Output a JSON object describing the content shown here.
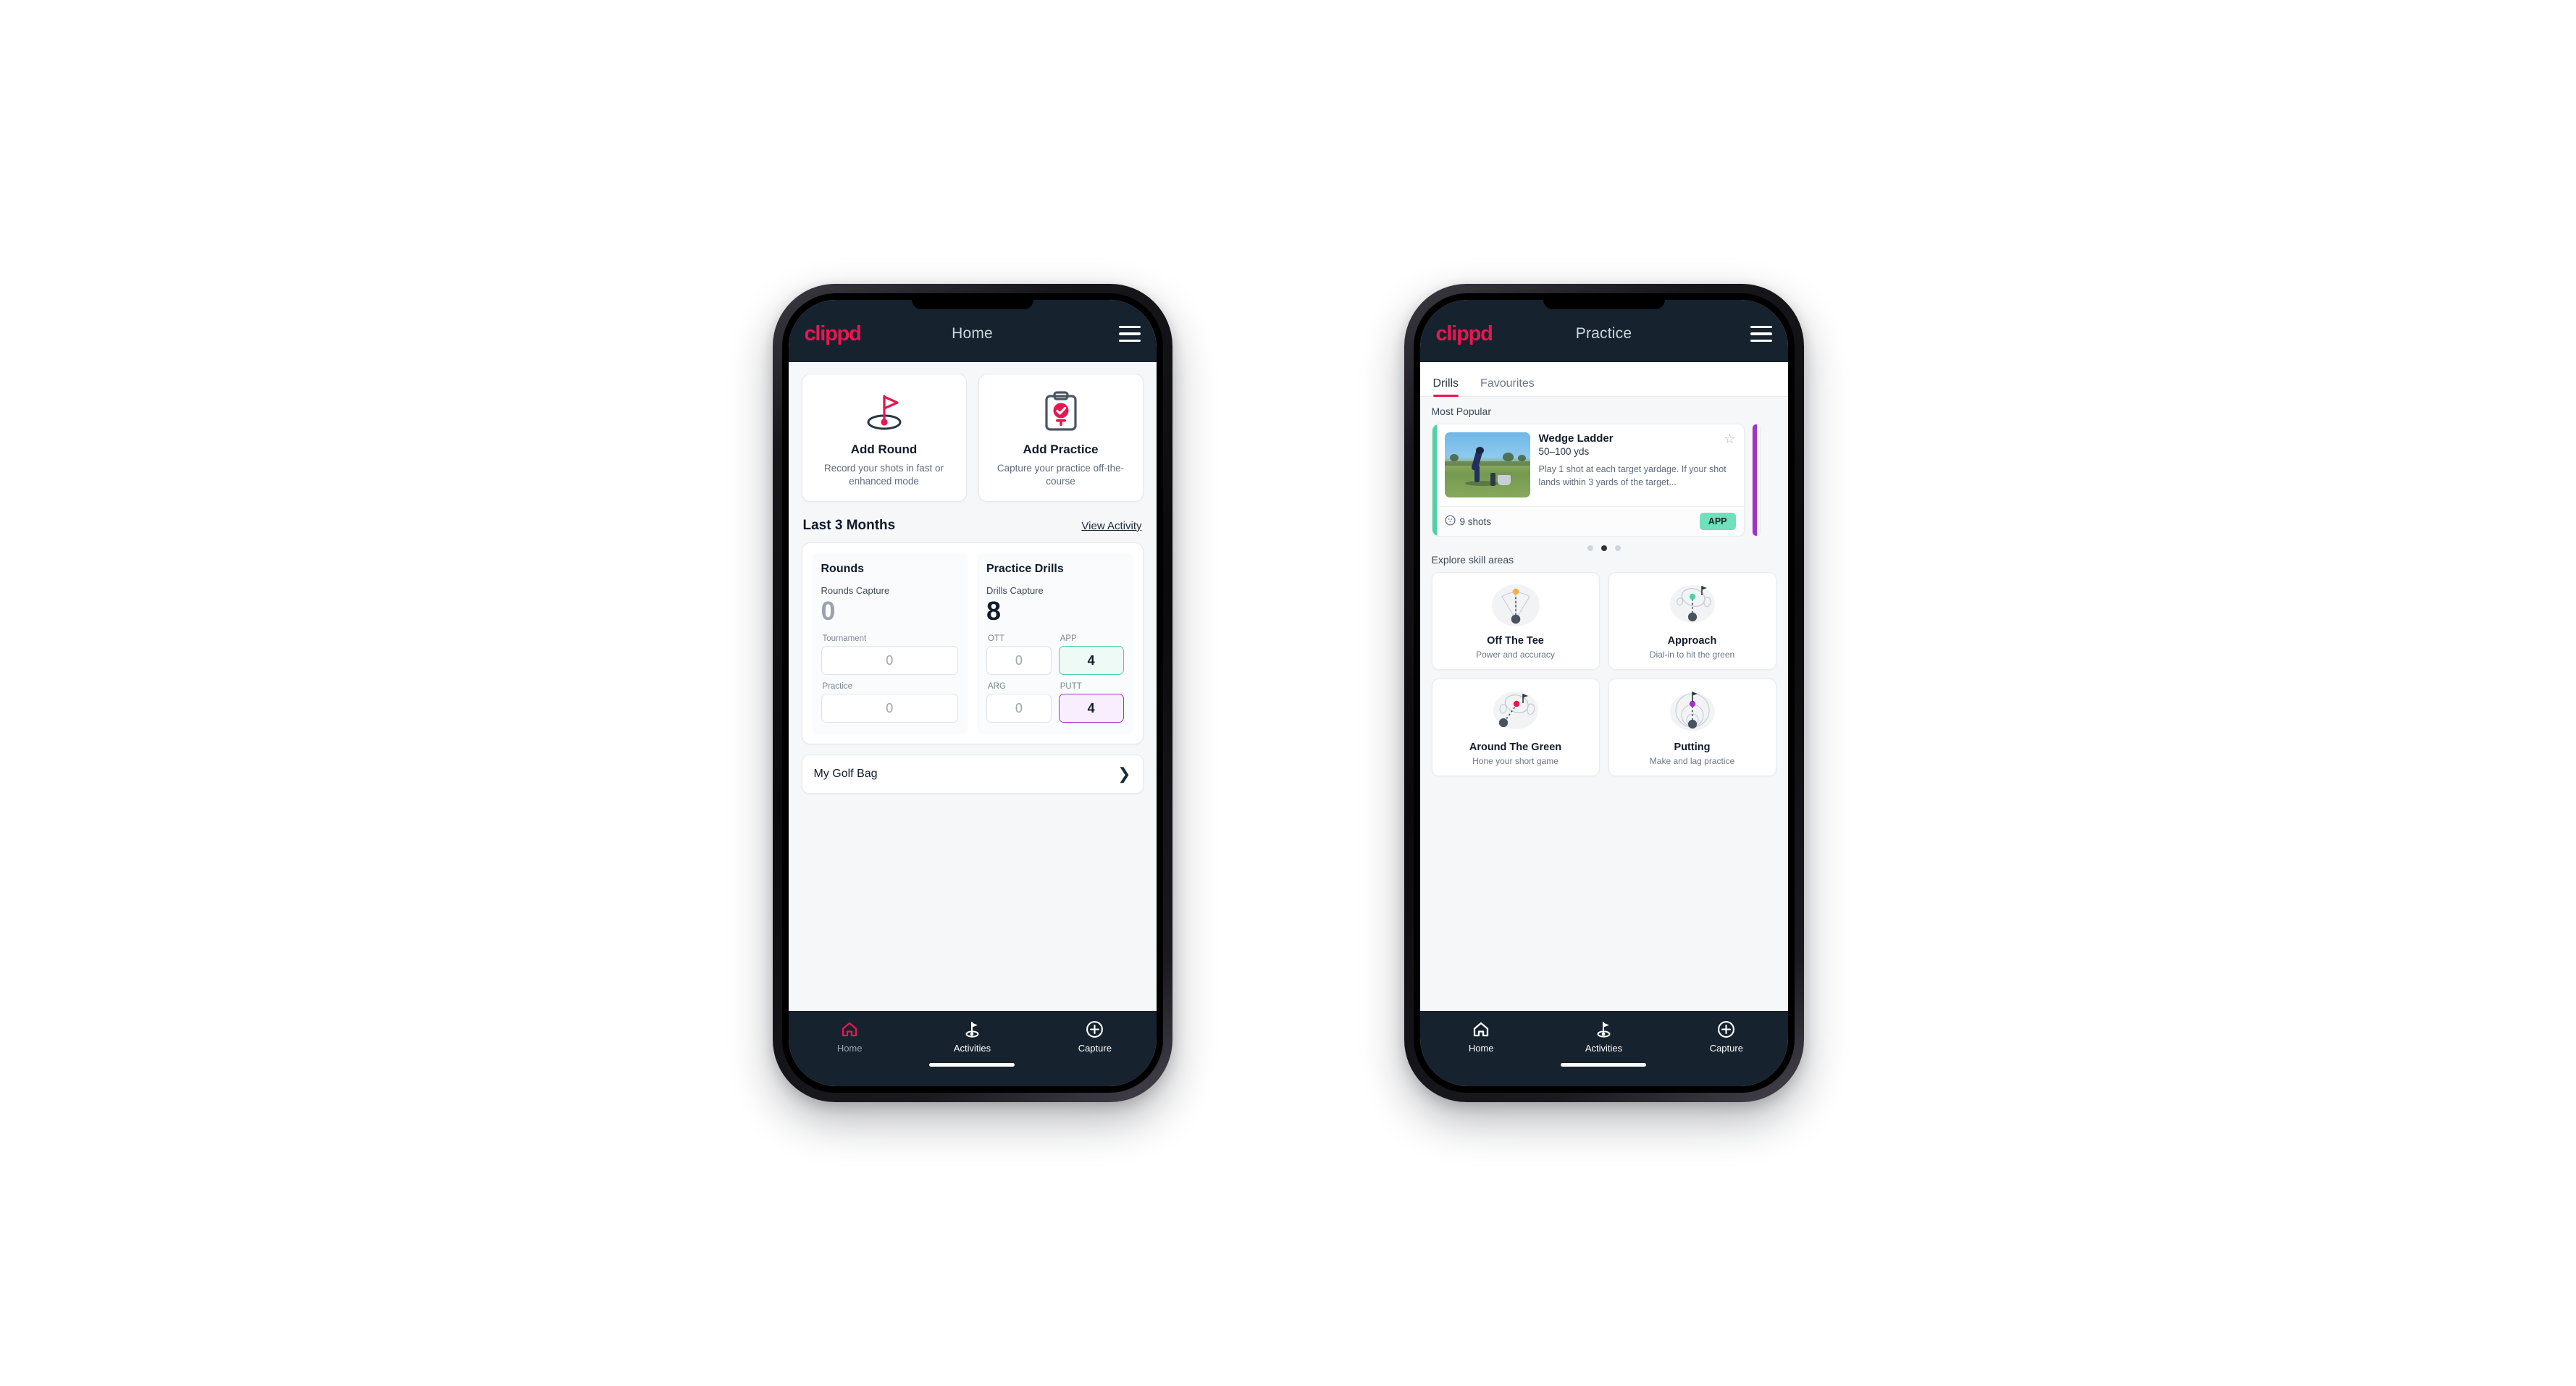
{
  "app": {
    "logo_text": "clippd",
    "brand_color": "#e8174f"
  },
  "phone_home": {
    "header": {
      "title": "Home",
      "menu_icon": "hamburger-icon"
    },
    "actions": [
      {
        "icon": "golf-flag-pin-icon",
        "title": "Add Round",
        "subtitle": "Record your shots in fast or enhanced mode"
      },
      {
        "icon": "clipboard-check-tee-icon",
        "title": "Add Practice",
        "subtitle": "Capture your practice off-the-course"
      }
    ],
    "section": {
      "title": "Last 3 Months",
      "link": "View Activity"
    },
    "stats": {
      "rounds": {
        "heading": "Rounds",
        "capture_label": "Rounds Capture",
        "capture_value": "0",
        "fields": [
          {
            "label": "Tournament",
            "value": "0",
            "state": "empty"
          },
          {
            "label": "Practice",
            "value": "0",
            "state": "empty"
          }
        ]
      },
      "drills": {
        "heading": "Practice Drills",
        "capture_label": "Drills Capture",
        "capture_value": "8",
        "fields": [
          {
            "label": "OTT",
            "value": "0",
            "state": "empty"
          },
          {
            "label": "APP",
            "value": "4",
            "state": "active-app",
            "color": "#4fd1a5"
          },
          {
            "label": "ARG",
            "value": "0",
            "state": "empty"
          },
          {
            "label": "PUTT",
            "value": "4",
            "state": "active-putt",
            "color": "#a233c9"
          }
        ]
      }
    },
    "golf_bag": {
      "label": "My Golf Bag",
      "chevron": "chevron-right-icon"
    },
    "bottom_nav": [
      {
        "icon": "home-icon",
        "label": "Home",
        "active": true
      },
      {
        "icon": "golf-flag-icon",
        "label": "Activities",
        "active": false
      },
      {
        "icon": "plus-circle-icon",
        "label": "Capture",
        "active": false
      }
    ]
  },
  "phone_practice": {
    "header": {
      "title": "Practice",
      "menu_icon": "hamburger-icon"
    },
    "tabs": [
      {
        "label": "Drills",
        "active": true
      },
      {
        "label": "Favourites",
        "active": false
      }
    ],
    "most_popular": {
      "heading": "Most Popular",
      "card": {
        "accent_color": "#4fd1a5",
        "title": "Wedge Ladder",
        "yardage": "50–100 yds",
        "description": "Play 1 shot at each target yardage. If your shot lands within 3 yards of the target...",
        "star_icon": "star-outline-icon",
        "shots_icon": "golf-ball-icon",
        "shots_label": "9 shots",
        "badge": "APP",
        "badge_color": "#6ee0bb",
        "thumbnail": "golfer-wedge-photo"
      },
      "next_card_accent": "#a233c9",
      "dots": {
        "count": 3,
        "active_index": 1
      }
    },
    "skill_areas": {
      "heading": "Explore skill areas",
      "cards": [
        {
          "art": "off-the-tee-fan-icon",
          "title": "Off The Tee",
          "subtitle": "Power and accuracy",
          "dot_color": "#f5b13d"
        },
        {
          "art": "approach-green-icon",
          "title": "Approach",
          "subtitle": "Dial-in to hit the green",
          "dot_color": "#4fd1a5"
        },
        {
          "art": "around-the-green-icon",
          "title": "Around The Green",
          "subtitle": "Hone your short game",
          "dot_color": "#e8174f"
        },
        {
          "art": "putting-rings-icon",
          "title": "Putting",
          "subtitle": "Make and lag practice",
          "dot_color": "#a233c9"
        }
      ]
    },
    "bottom_nav": [
      {
        "icon": "home-icon",
        "label": "Home",
        "active": false
      },
      {
        "icon": "golf-flag-icon",
        "label": "Activities",
        "active": true
      },
      {
        "icon": "plus-circle-icon",
        "label": "Capture",
        "active": false
      }
    ]
  }
}
